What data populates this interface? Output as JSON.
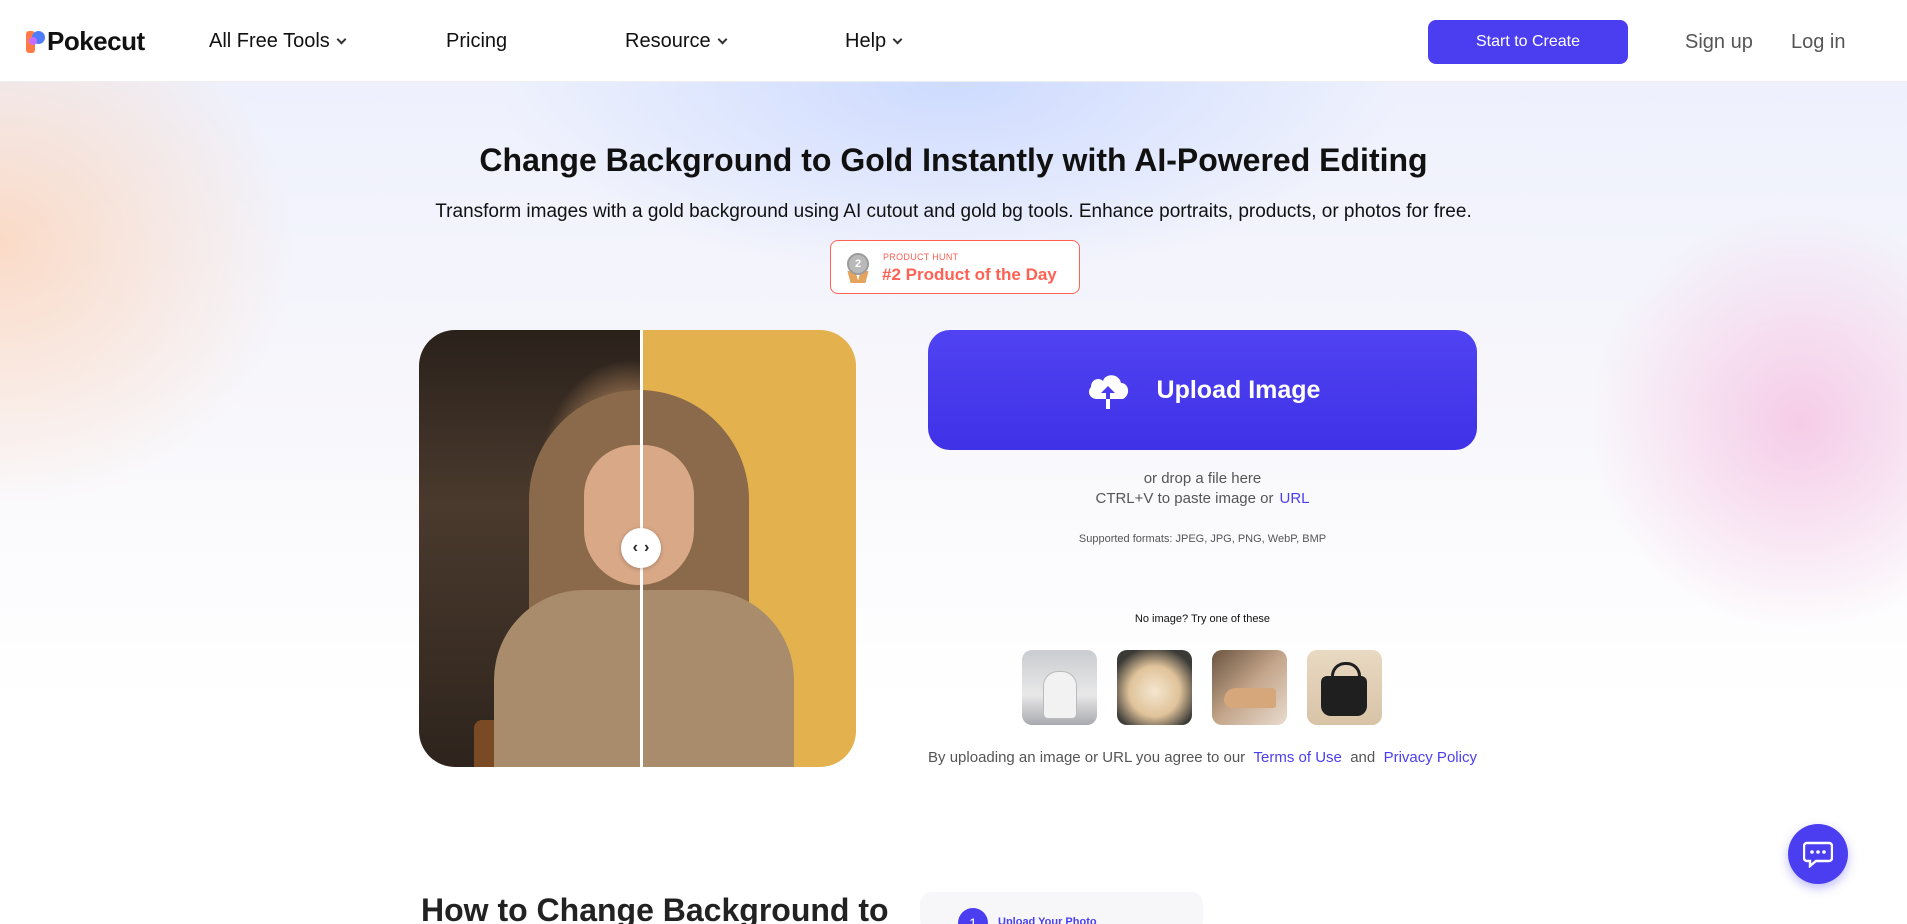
{
  "brand": {
    "name": "Pokecut"
  },
  "nav": {
    "items": [
      {
        "label": "All Free Tools",
        "has_dropdown": true
      },
      {
        "label": "Pricing",
        "has_dropdown": false
      },
      {
        "label": "Resource",
        "has_dropdown": true
      },
      {
        "label": "Help",
        "has_dropdown": true
      }
    ],
    "cta": "Start to Create",
    "sign_up": "Sign up",
    "log_in": "Log in"
  },
  "hero": {
    "title": "Change Background to Gold Instantly with AI-Powered Editing",
    "subtitle": "Transform images with a gold background using AI cutout and gold bg tools. Enhance portraits, products, or photos for free.",
    "badge": {
      "kicker": "PRODUCT HUNT",
      "text": "#2 Product of the Day",
      "rank": "2"
    }
  },
  "compare": {
    "before_bg": "photo",
    "after_bg_color": "#e3b24f",
    "slider_position": 0.5
  },
  "upload": {
    "button_label": "Upload Image",
    "drop_text": "or drop a file here",
    "paste_text": "CTRL+V to paste image or",
    "url_link": "URL",
    "formats": "Supported formats: JPEG, JPG, PNG, WebP, BMP",
    "try_label": "No image? Try one of these",
    "samples": [
      "woman-sample",
      "dog-sample",
      "shoes-sample",
      "handbag-sample"
    ]
  },
  "legal": {
    "prefix": "By uploading an image or URL you agree to our",
    "terms": "Terms of Use",
    "and": "and",
    "privacy": "Privacy Policy"
  },
  "how_to": {
    "title": "How to Change Background to",
    "step_number": "1",
    "step_label": "Upload Your Photo"
  },
  "colors": {
    "accent": "#4b3ef0",
    "badge": "#ff6154",
    "gold": "#e3b24f"
  }
}
